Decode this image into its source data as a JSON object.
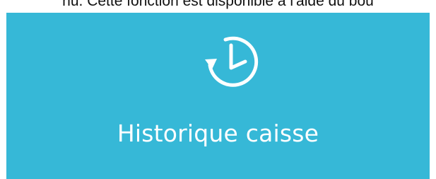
{
  "header": {
    "partial_text": "nu. Cette fonction est disponible à l'aide du bou"
  },
  "tile": {
    "label": "Historique caisse",
    "icon": "history-clock-icon",
    "background_color": "#36b8d7",
    "foreground_color": "#ffffff"
  }
}
